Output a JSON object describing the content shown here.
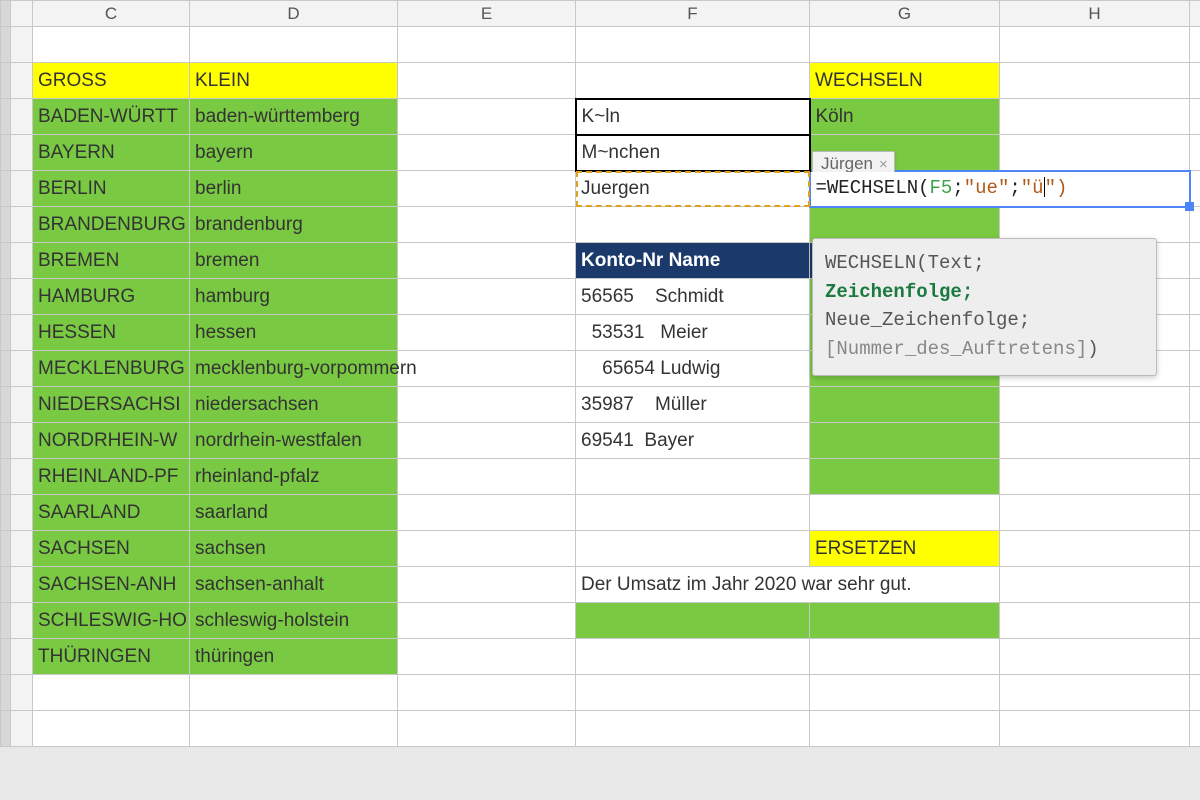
{
  "columns": [
    "C",
    "D",
    "E",
    "F",
    "G",
    "H"
  ],
  "headers": {
    "gross": "GROSS",
    "klein": "KLEIN",
    "wechseln": "WECHSELN",
    "ersetzen": "ERSETZEN"
  },
  "states_upper": [
    "BADEN-WÜRTT",
    "BAYERN",
    "BERLIN",
    "BRANDENBURG",
    "BREMEN",
    "HAMBURG",
    "HESSEN",
    "MECKLENBURG",
    "NIEDERSACHSI",
    "NORDRHEIN-W",
    "RHEINLAND-PF",
    "SAARLAND",
    "SACHSEN",
    "SACHSEN-ANH",
    "SCHLESWIG-HO",
    "THÜRINGEN"
  ],
  "states_lower": [
    "baden-württemberg",
    "bayern",
    "berlin",
    "brandenburg",
    "bremen",
    "hamburg",
    "hessen",
    "mecklenburg-vorpommern",
    "niedersachsen",
    "nordrhein-westfalen",
    "rheinland-pfalz",
    "saarland",
    "sachsen",
    "sachsen-anhalt",
    "schleswig-holstein",
    "thüringen"
  ],
  "examples_f": [
    "K~ln",
    "M~nchen",
    "Juergen"
  ],
  "examples_g": [
    "Köln"
  ],
  "formula": {
    "prefix": "=WECHSELN(",
    "ref": "F5",
    "sep1": ";",
    "arg2": "\"ue\"",
    "sep2": ";",
    "arg3_open": "\"ü",
    "arg3_close": "\")",
    "display": "=WECHSELN(F5;\"ue\";\"ü\")"
  },
  "chip": {
    "text": "Jürgen",
    "close": "×"
  },
  "tooltip": {
    "fn": "WECHSELN",
    "arg1": "Text;",
    "arg2": "Zeichenfolge;",
    "arg3": "Neue_Zeichenfolge;",
    "arg4": "[Nummer_des_Auftretens]"
  },
  "table": {
    "header": "Konto-Nr Name",
    "rows": [
      {
        "nr": "56565",
        "name": "Schmidt",
        "align": "left"
      },
      {
        "nr": "53531",
        "name": "Meier",
        "align": "mid"
      },
      {
        "nr": "65654",
        "name": "Ludwig",
        "align": "right"
      },
      {
        "nr": "35987",
        "name": "Müller",
        "align": "left"
      },
      {
        "nr": "69541",
        "name": "Bayer",
        "align": "left"
      }
    ]
  },
  "sentence": "Der Umsatz im Jahr 2020 war sehr gut.",
  "colors": {
    "green": "#7ac943",
    "yellow": "#ffff00",
    "navy": "#1b3a6b",
    "blue": "#4f86f7"
  }
}
